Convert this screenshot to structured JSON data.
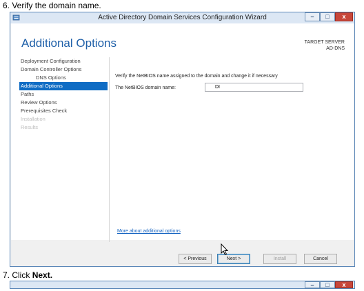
{
  "instructions": {
    "step6": "6. Verify the domain name.",
    "step7_prefix": "7. Click ",
    "step7_bold": "Next."
  },
  "window": {
    "title": "Active Directory Domain Services Configuration Wizard",
    "min_glyph": "–",
    "max_glyph": "□",
    "close_glyph": "x"
  },
  "page": {
    "title": "Additional Options",
    "target_server_label": "TARGET SERVER",
    "target_server_name": "AD-DNS"
  },
  "nav": {
    "items": [
      {
        "label": "Deployment Configuration"
      },
      {
        "label": "Domain Controller Options"
      },
      {
        "label": "DNS Options"
      },
      {
        "label": "Additional Options"
      },
      {
        "label": "Paths"
      },
      {
        "label": "Review Options"
      },
      {
        "label": "Prerequisites Check"
      },
      {
        "label": "Installation"
      },
      {
        "label": "Results"
      }
    ]
  },
  "main": {
    "instruction": "Verify the NetBIOS name assigned to the domain and change it if necessary",
    "netbios_label": "The NetBIOS domain name:",
    "netbios_value": "DI",
    "more_link": "More about additional options"
  },
  "buttons": {
    "previous": "< Previous",
    "next": "Next >",
    "install": "Install",
    "cancel": "Cancel"
  },
  "colors": {
    "accent": "#0f6cc4",
    "title_blue": "#1e5fa8",
    "close_red": "#c7463a"
  },
  "icons": {
    "app": "server-manager-icon",
    "cursor": "mouse-pointer-icon"
  }
}
